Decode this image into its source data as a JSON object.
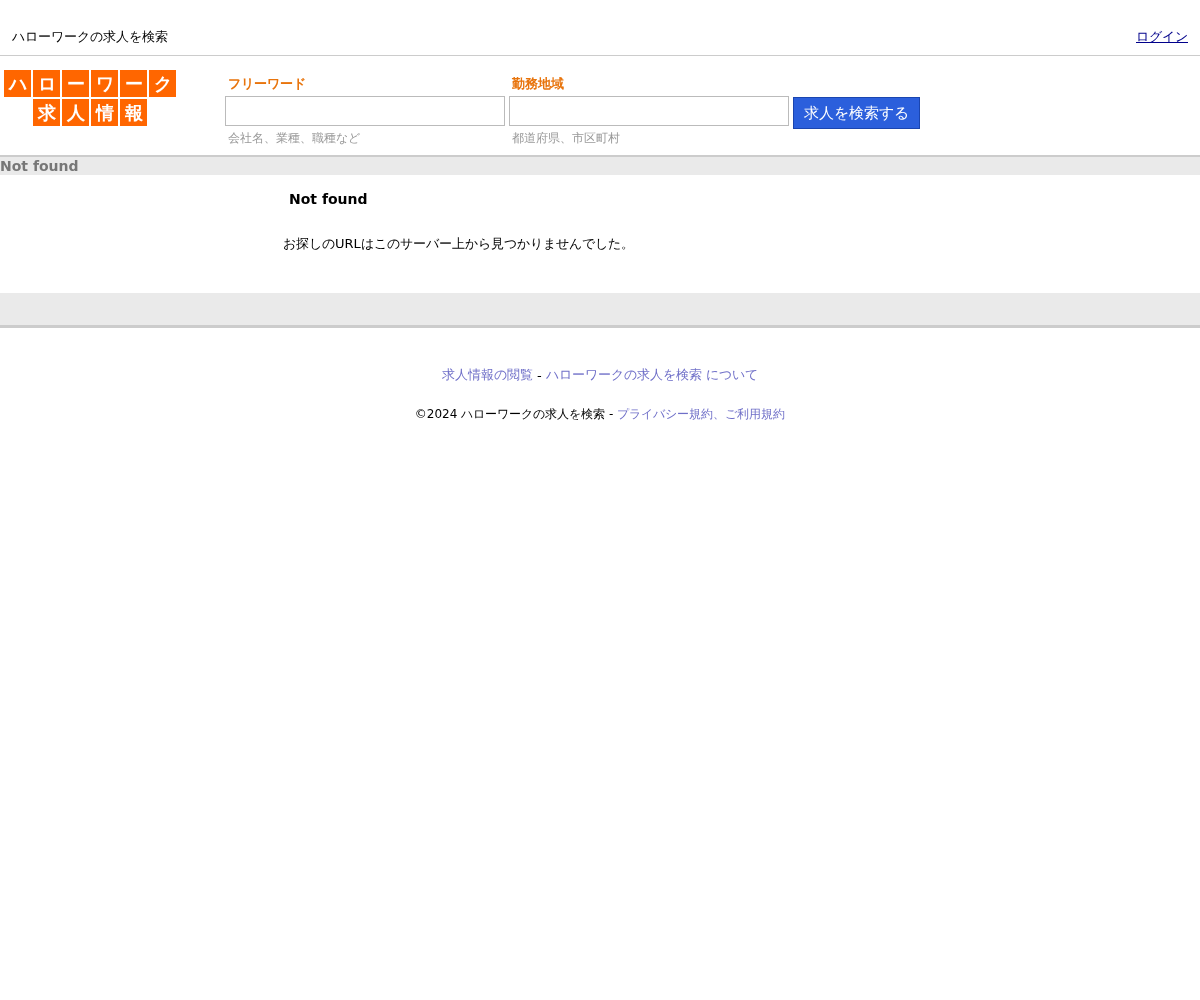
{
  "header": {
    "site_title": "ハローワークの求人を検索",
    "login_link": "ログイン"
  },
  "logo": {
    "rows": [
      "ハローワーク",
      "求人情報"
    ]
  },
  "search": {
    "fields": [
      {
        "label": "フリーワード",
        "hint": "会社名、業種、職種など"
      },
      {
        "label": "勤務地域",
        "hint": "都道府県、市区町村"
      }
    ],
    "button": "求人を検索する"
  },
  "section_bar": {
    "title": "Not found"
  },
  "content": {
    "heading": "Not found",
    "message": "お探しのURLはこのサーバー上から見つかりませんでした。"
  },
  "footer": {
    "links": [
      "求人情報の閲覧",
      "ハローワークの求人を検索 について"
    ],
    "separator": "-",
    "copyright": "©2024 ハローワークの求人を検索 -",
    "legal_link": "プライバシー規約、ご利用規約"
  }
}
